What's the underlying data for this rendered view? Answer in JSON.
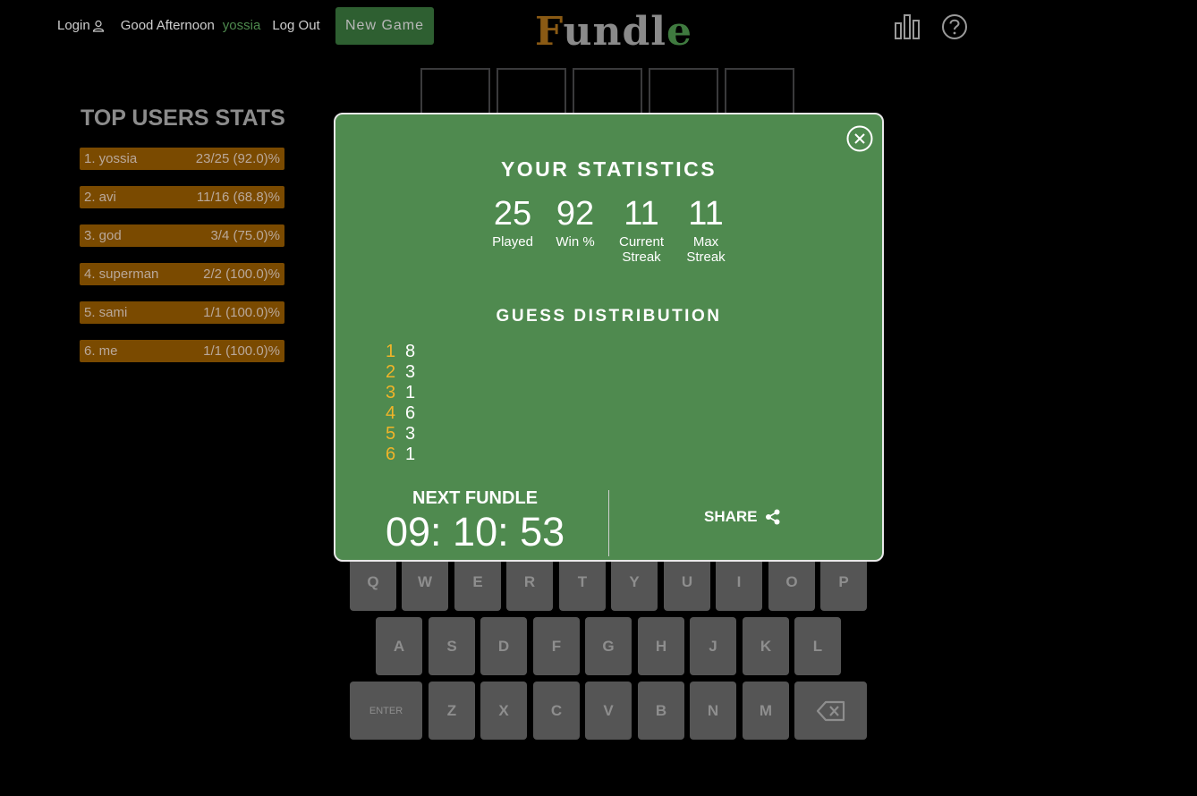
{
  "nav": {
    "login": "Login",
    "greeting": "Good Afternoon",
    "username": "yossia",
    "logout": "Log Out",
    "new_game": "New Game"
  },
  "logo": {
    "letters": [
      "F",
      "u",
      "n",
      "d",
      "l",
      "e"
    ],
    "colors": [
      "#8a5a14",
      "#8a8a8a",
      "#8a8a8a",
      "#8a8a8a",
      "#8a8a8a",
      "#3f7a3f"
    ]
  },
  "header_icons": [
    "bar-chart-icon",
    "help-icon"
  ],
  "top_users": {
    "title": "TOP USERS STATS",
    "rows": [
      {
        "name": "1. yossia",
        "score": "23/25 (92.0)%"
      },
      {
        "name": "2. avi",
        "score": "11/16 (68.8)%"
      },
      {
        "name": "3. god",
        "score": "3/4 (75.0)%"
      },
      {
        "name": "4. superman",
        "score": "2/2 (100.0)%"
      },
      {
        "name": "5. sami",
        "score": "1/1 (100.0)%"
      },
      {
        "name": "6. me",
        "score": "1/1 (100.0)%"
      }
    ]
  },
  "modal": {
    "title": "YOUR STATISTICS",
    "stats": [
      {
        "value": "25",
        "label": "Played"
      },
      {
        "value": "92",
        "label": "Win %"
      },
      {
        "value": "11",
        "label": "Current Streak"
      },
      {
        "value": "11",
        "label": "Max Streak"
      }
    ],
    "dist_title": "GUESS DISTRIBUTION",
    "distribution": [
      {
        "guess": "1",
        "count": "8"
      },
      {
        "guess": "2",
        "count": "3"
      },
      {
        "guess": "3",
        "count": "1"
      },
      {
        "guess": "4",
        "count": "6"
      },
      {
        "guess": "5",
        "count": "3"
      },
      {
        "guess": "6",
        "count": "1"
      }
    ],
    "next_title": "NEXT FUNDLE",
    "timer": "09: 10: 53",
    "share": "SHARE"
  },
  "keyboard": {
    "row1": [
      "Q",
      "W",
      "E",
      "R",
      "T",
      "Y",
      "U",
      "I",
      "O",
      "P"
    ],
    "row2": [
      "A",
      "S",
      "D",
      "F",
      "G",
      "H",
      "J",
      "K",
      "L"
    ],
    "row3_enter": "ENTER",
    "row3": [
      "Z",
      "X",
      "C",
      "V",
      "B",
      "N",
      "M"
    ]
  },
  "colors": {
    "modal_bg": "#4f8a4f",
    "user_row_bg": "#7a4a00",
    "new_game_bg": "#2e5f31",
    "accent_yellow": "#f0b429"
  }
}
